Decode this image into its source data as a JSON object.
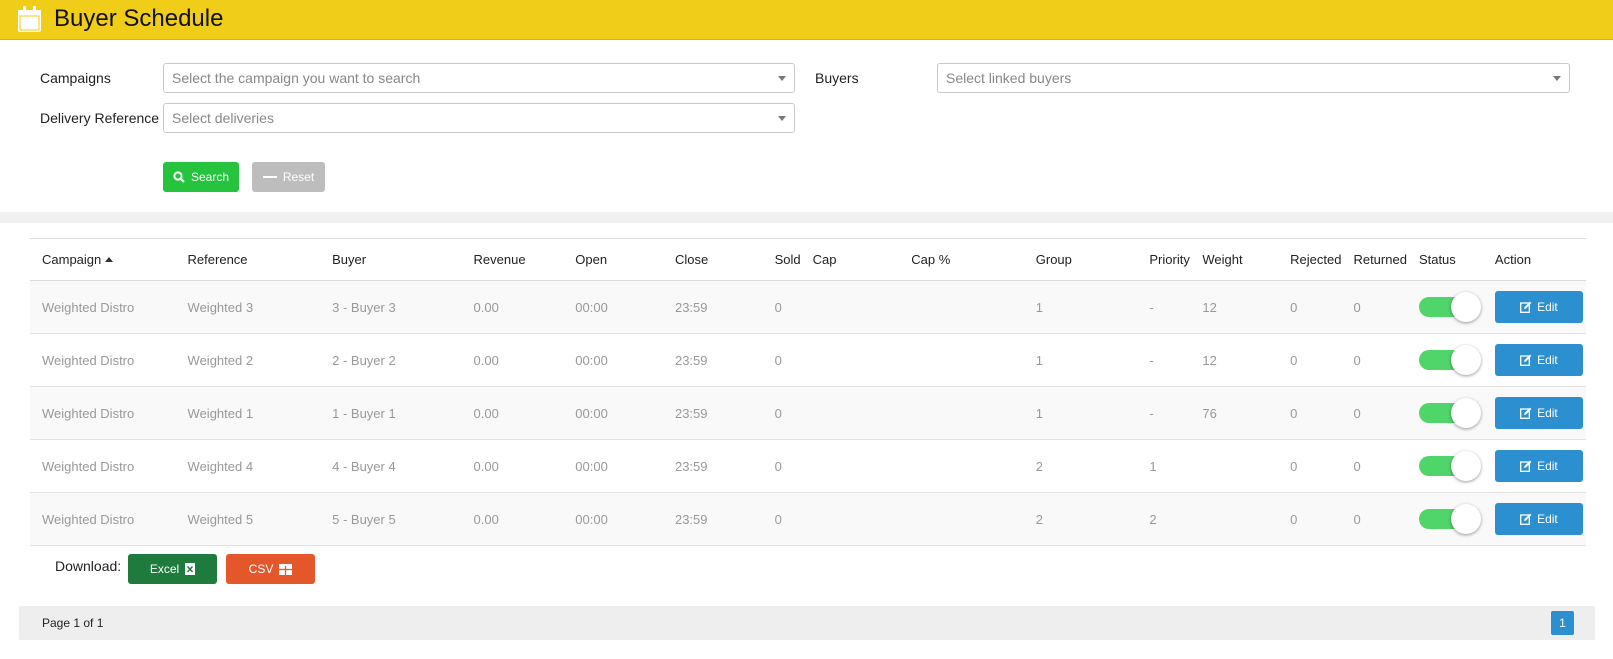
{
  "header": {
    "title": "Buyer Schedule",
    "icon": "calendar-icon"
  },
  "filters": {
    "campaigns_label": "Campaigns",
    "campaigns_placeholder": "Select the campaign you want to search",
    "buyers_label": "Buyers",
    "buyers_placeholder": "Select linked buyers",
    "delivery_label": "Delivery Reference",
    "delivery_placeholder": "Select deliveries",
    "search_label": "Search",
    "reset_label": "Reset"
  },
  "table": {
    "columns": [
      "Campaign",
      "Reference",
      "Buyer",
      "Revenue",
      "Open",
      "Close",
      "Sold",
      "Cap",
      "Cap %",
      "Group",
      "Priority",
      "Weight",
      "Rejected",
      "Returned",
      "Status",
      "Action"
    ],
    "rows": [
      {
        "campaign": "Weighted Distro",
        "reference": "Weighted 3",
        "buyer": "3 - Buyer 3",
        "revenue": "0.00",
        "open": "00:00",
        "close": "23:59",
        "sold": "0",
        "cap": "",
        "cap_pct": "",
        "group": "1",
        "priority": "-",
        "weight": "12",
        "rejected": "0",
        "returned": "0",
        "status": "on",
        "action": "Edit"
      },
      {
        "campaign": "Weighted Distro",
        "reference": "Weighted 2",
        "buyer": "2 - Buyer 2",
        "revenue": "0.00",
        "open": "00:00",
        "close": "23:59",
        "sold": "0",
        "cap": "",
        "cap_pct": "",
        "group": "1",
        "priority": "-",
        "weight": "12",
        "rejected": "0",
        "returned": "0",
        "status": "on",
        "action": "Edit"
      },
      {
        "campaign": "Weighted Distro",
        "reference": "Weighted 1",
        "buyer": "1 - Buyer 1",
        "revenue": "0.00",
        "open": "00:00",
        "close": "23:59",
        "sold": "0",
        "cap": "",
        "cap_pct": "",
        "group": "1",
        "priority": "-",
        "weight": "76",
        "rejected": "0",
        "returned": "0",
        "status": "on",
        "action": "Edit"
      },
      {
        "campaign": "Weighted Distro",
        "reference": "Weighted 4",
        "buyer": "4 - Buyer 4",
        "revenue": "0.00",
        "open": "00:00",
        "close": "23:59",
        "sold": "0",
        "cap": "",
        "cap_pct": "",
        "group": "2",
        "priority": "1",
        "weight": "",
        "rejected": "0",
        "returned": "0",
        "status": "on",
        "action": "Edit"
      },
      {
        "campaign": "Weighted Distro",
        "reference": "Weighted 5",
        "buyer": "5 - Buyer 5",
        "revenue": "0.00",
        "open": "00:00",
        "close": "23:59",
        "sold": "0",
        "cap": "",
        "cap_pct": "",
        "group": "2",
        "priority": "2",
        "weight": "",
        "rejected": "0",
        "returned": "0",
        "status": "on",
        "action": "Edit"
      }
    ]
  },
  "download": {
    "label": "Download:",
    "excel_label": "Excel",
    "csv_label": "CSV"
  },
  "pager": {
    "text": "Page 1 of 1",
    "current": "1"
  },
  "colors": {
    "header": "#f0cd18",
    "search": "#25c33e",
    "edit": "#2b8fd0",
    "excel": "#1e7a3d",
    "csv": "#e3572b",
    "toggle_on": "#4fd56a"
  }
}
